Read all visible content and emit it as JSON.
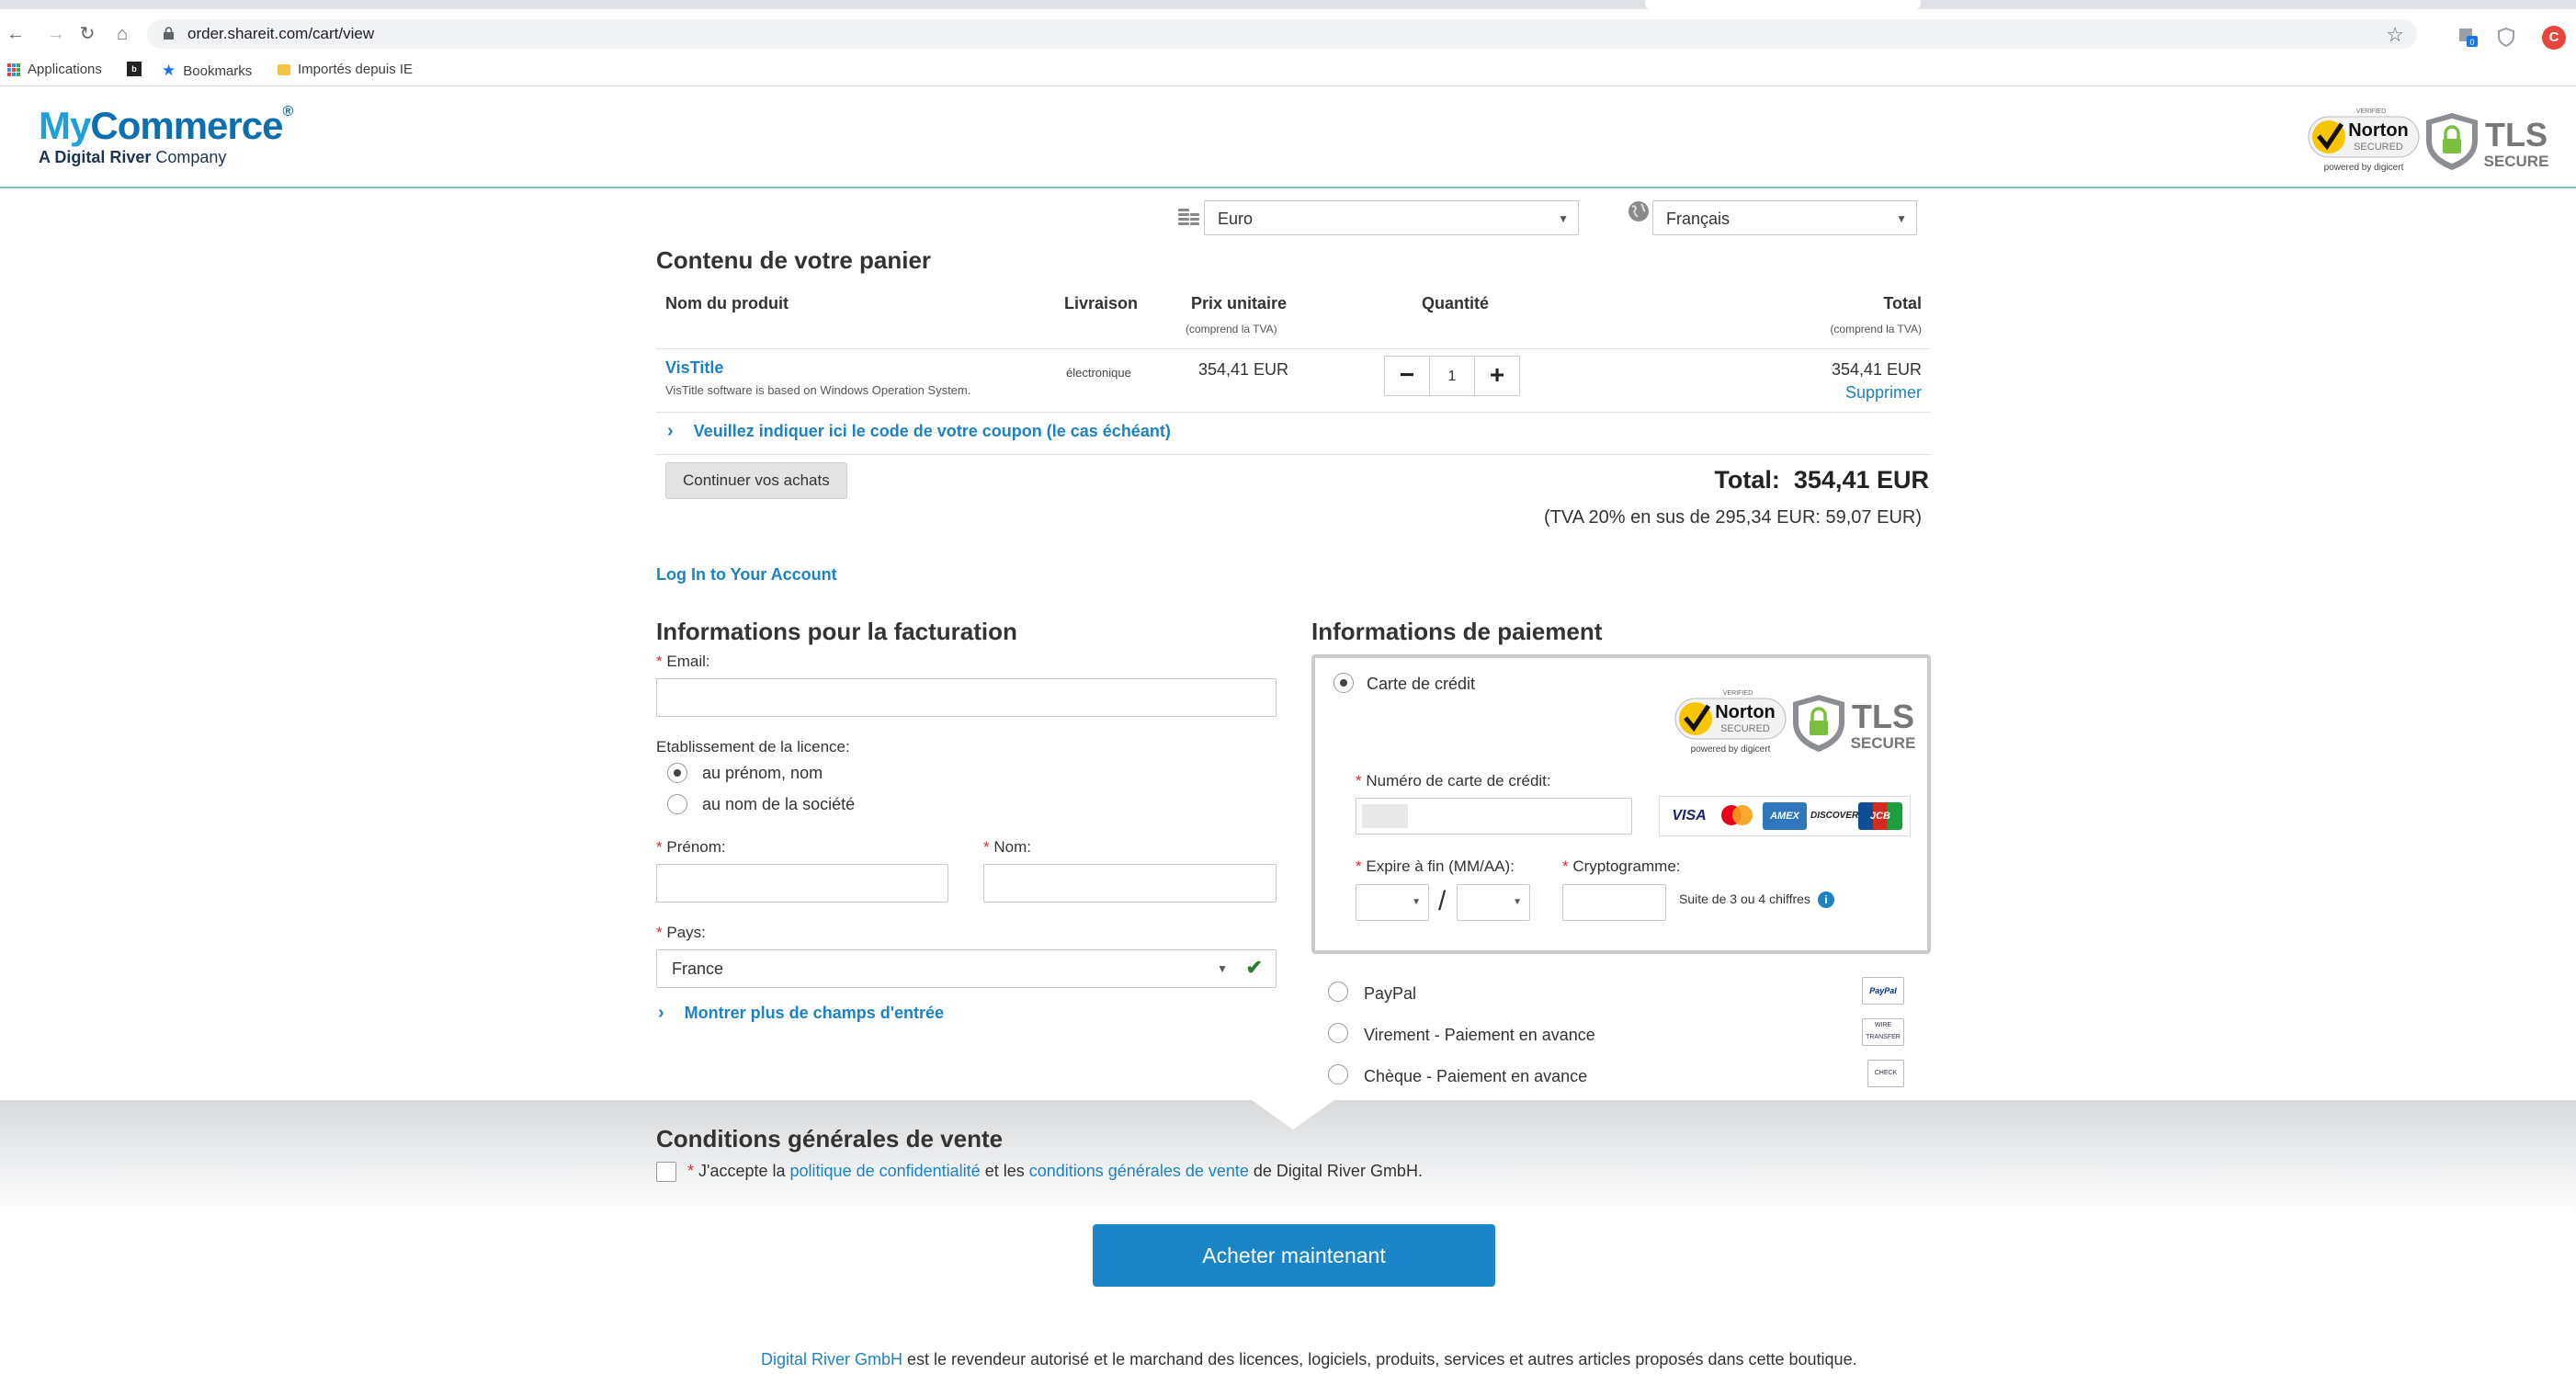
{
  "browser": {
    "url": "order.shareit.com/cart/view",
    "bookmarks": [
      "Applications",
      "Bookmarks",
      "Importés depuis IE"
    ],
    "profile_initial": "C",
    "ext_badge": "0"
  },
  "header": {
    "brand_my": "My",
    "brand_commerce": "Commerce",
    "brand_reg": "®",
    "brand_sub_a": "A Digital River",
    "brand_sub_b": " Company",
    "norton_small": "VERIFIED",
    "norton_text": "Norton",
    "norton_secured": "SECURED",
    "norton_powered": "powered by digicert",
    "tls_text": "TLS",
    "tls_secure": "SECURE"
  },
  "selects": {
    "currency": "Euro",
    "language": "Français"
  },
  "cart": {
    "title": "Contenu de votre panier",
    "col_product": "Nom du produit",
    "col_delivery": "Livraison",
    "col_unit_price": "Prix unitaire",
    "col_unit_price_sub": "(comprend la TVA)",
    "col_quantity": "Quantité",
    "col_total": "Total",
    "col_total_sub": "(comprend la TVA)",
    "item": {
      "name": "VisTitle",
      "description": "VisTitle software is based on Windows Operation System.",
      "delivery": "électronique",
      "unit_price": "354,41 EUR",
      "quantity": "1",
      "total": "354,41 EUR",
      "remove": "Supprimer"
    },
    "qty_minus": "−",
    "qty_plus": "+",
    "coupon_link": "Veuillez indiquer ici le code de votre coupon (le cas échéant)",
    "continue_button": "Continuer vos achats",
    "total_label": "Total:",
    "total_value": "354,41 EUR",
    "vat_note": "(TVA 20% en sus de 295,34 EUR: 59,07 EUR)",
    "login_link": "Log In to Your Account"
  },
  "billing": {
    "title": "Informations pour la facturation",
    "email_label": "Email:",
    "license_label": "Etablissement de la licence:",
    "license_option_1": "au prénom, nom",
    "license_option_2": "au nom de la société",
    "license_selected": "au prénom, nom",
    "firstname_label": "Prénom:",
    "lastname_label": "Nom:",
    "country_label": "Pays:",
    "country_value": "France",
    "more_fields_link": "Montrer plus de champs d'entrée",
    "required_mark": "*"
  },
  "payment": {
    "title": "Informations de paiement",
    "credit_card_label": "Carte de crédit",
    "card_number_label": "Numéro de carte de crédit:",
    "expiry_label": "Expire à fin (MM/AA):",
    "expiry_sep": "/",
    "cvv_label": "Cryptogramme:",
    "cvv_hint": "Suite de 3 ou 4 chiffres",
    "info_icon_glyph": "i",
    "card_brands": [
      "VISA",
      "MC",
      "AMEX",
      "DISCOVER",
      "JCB"
    ],
    "paypal_label": "PayPal",
    "wire_label": "Virement - Paiement en avance",
    "cheque_label": "Chèque - Paiement en avance",
    "paypal_icon_text": "PayPal",
    "wire_icon_text": "WIRE TRANSFER",
    "cheque_icon_text": "CHECK",
    "selected_method": "Carte de crédit"
  },
  "terms": {
    "title": "Conditions générales de vente",
    "text_a": "J'accepte la ",
    "privacy_link": "politique de confidentialité",
    "text_b": " et les ",
    "terms_link": "conditions générales de vente",
    "text_c": " de Digital River GmbH."
  },
  "buy_button": "Acheter maintenant",
  "footer": {
    "link": "Digital River GmbH",
    "text": " est le revendeur autorisé et le marchand des licences, logiciels, produits, services et autres articles proposés dans cette boutique."
  },
  "colors": {
    "accent": "#1c82c4",
    "button": "#1a86c8",
    "required": "#d32f2f",
    "header_rule": "#7fc3cf"
  }
}
